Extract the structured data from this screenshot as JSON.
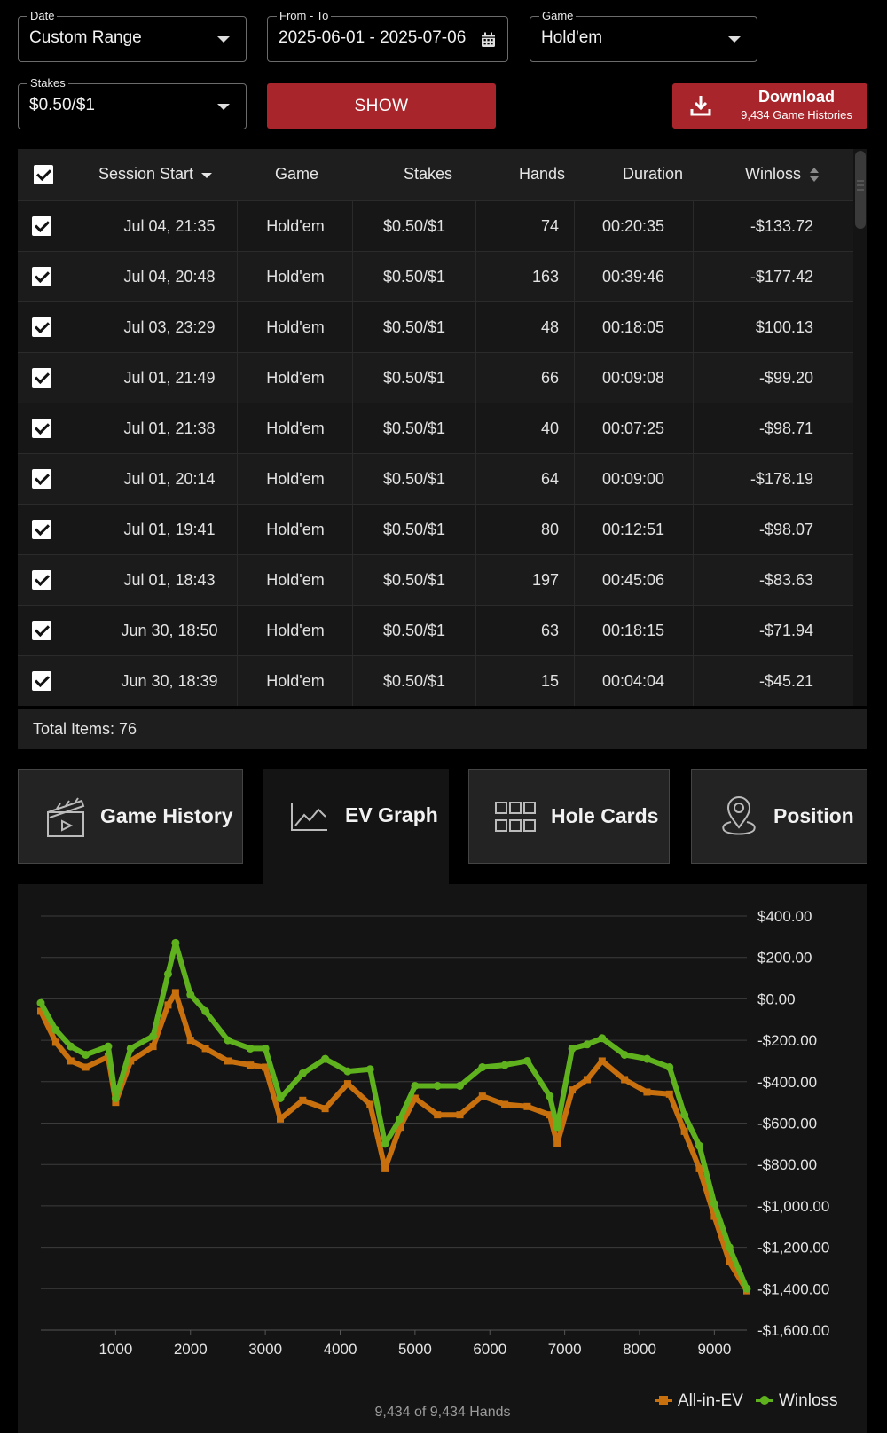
{
  "filters": {
    "date": {
      "label": "Date",
      "value": "Custom Range"
    },
    "range": {
      "label": "From - To",
      "value": "2025-06-01 - 2025-07-06"
    },
    "game": {
      "label": "Game",
      "value": "Hold'em"
    },
    "stakes": {
      "label": "Stakes",
      "value": "$0.50/$1"
    },
    "show_label": "SHOW",
    "download": {
      "title": "Download",
      "subtitle": "9,434 Game Histories"
    }
  },
  "table": {
    "headers": {
      "session_start": "Session Start",
      "game": "Game",
      "stakes": "Stakes",
      "hands": "Hands",
      "duration": "Duration",
      "winloss": "Winloss"
    },
    "rows": [
      {
        "start": "Jul 04, 21:35",
        "game": "Hold'em",
        "stakes": "$0.50/$1",
        "hands": "74",
        "duration": "00:20:35",
        "winloss": "-$133.72"
      },
      {
        "start": "Jul 04, 20:48",
        "game": "Hold'em",
        "stakes": "$0.50/$1",
        "hands": "163",
        "duration": "00:39:46",
        "winloss": "-$177.42"
      },
      {
        "start": "Jul 03, 23:29",
        "game": "Hold'em",
        "stakes": "$0.50/$1",
        "hands": "48",
        "duration": "00:18:05",
        "winloss": "$100.13"
      },
      {
        "start": "Jul 01, 21:49",
        "game": "Hold'em",
        "stakes": "$0.50/$1",
        "hands": "66",
        "duration": "00:09:08",
        "winloss": "-$99.20"
      },
      {
        "start": "Jul 01, 21:38",
        "game": "Hold'em",
        "stakes": "$0.50/$1",
        "hands": "40",
        "duration": "00:07:25",
        "winloss": "-$98.71"
      },
      {
        "start": "Jul 01, 20:14",
        "game": "Hold'em",
        "stakes": "$0.50/$1",
        "hands": "64",
        "duration": "00:09:00",
        "winloss": "-$178.19"
      },
      {
        "start": "Jul 01, 19:41",
        "game": "Hold'em",
        "stakes": "$0.50/$1",
        "hands": "80",
        "duration": "00:12:51",
        "winloss": "-$98.07"
      },
      {
        "start": "Jul 01, 18:43",
        "game": "Hold'em",
        "stakes": "$0.50/$1",
        "hands": "197",
        "duration": "00:45:06",
        "winloss": "-$83.63"
      },
      {
        "start": "Jun 30, 18:50",
        "game": "Hold'em",
        "stakes": "$0.50/$1",
        "hands": "63",
        "duration": "00:18:15",
        "winloss": "-$71.94"
      },
      {
        "start": "Jun 30, 18:39",
        "game": "Hold'em",
        "stakes": "$0.50/$1",
        "hands": "15",
        "duration": "00:04:04",
        "winloss": "-$45.21"
      }
    ],
    "total": "Total Items: 76"
  },
  "tabs": [
    {
      "label": "Game History",
      "icon": "clapperboard-icon"
    },
    {
      "label": "EV Graph",
      "icon": "line-chart-icon"
    },
    {
      "label": "Hole Cards",
      "icon": "grid-icon"
    },
    {
      "label": "Position",
      "icon": "location-pin-icon"
    }
  ],
  "chart_data": {
    "type": "line",
    "x_ticks": [
      1000,
      2000,
      3000,
      4000,
      5000,
      6000,
      7000,
      8000,
      9000
    ],
    "y_ticks": [
      400,
      200,
      0,
      -200,
      -400,
      -600,
      -800,
      -1000,
      -1200,
      -1400,
      -1600
    ],
    "y_tick_labels": [
      "$400.00",
      "$200.00",
      "$0.00",
      "-$200.00",
      "-$400.00",
      "-$600.00",
      "-$800.00",
      "-$1,000.00",
      "-$1,200.00",
      "-$1,400.00",
      "-$1,600.00"
    ],
    "xlim": [
      0,
      9434
    ],
    "ylim": [
      -1600,
      400
    ],
    "series": [
      {
        "name": "All-in-EV",
        "color": "#c8700e",
        "x": [
          0,
          200,
          400,
          600,
          900,
          1000,
          1200,
          1500,
          1700,
          1800,
          2000,
          2200,
          2500,
          2800,
          3000,
          3200,
          3500,
          3800,
          4100,
          4400,
          4600,
          4800,
          5000,
          5300,
          5600,
          5900,
          6200,
          6500,
          6800,
          6900,
          7100,
          7300,
          7500,
          7800,
          8100,
          8400,
          8600,
          8800,
          9000,
          9200,
          9434
        ],
        "y": [
          -60,
          -210,
          -300,
          -330,
          -280,
          -500,
          -300,
          -230,
          -30,
          30,
          -200,
          -240,
          -300,
          -320,
          -330,
          -580,
          -490,
          -530,
          -410,
          -510,
          -820,
          -620,
          -480,
          -560,
          -560,
          -470,
          -510,
          -520,
          -560,
          -700,
          -440,
          -390,
          -300,
          -390,
          -450,
          -460,
          -640,
          -820,
          -1050,
          -1270,
          -1410
        ]
      },
      {
        "name": "Winloss",
        "color": "#5fb21d",
        "x": [
          0,
          200,
          400,
          600,
          900,
          1000,
          1200,
          1500,
          1700,
          1800,
          2000,
          2200,
          2500,
          2800,
          3000,
          3200,
          3500,
          3800,
          4100,
          4400,
          4600,
          4800,
          5000,
          5300,
          5600,
          5900,
          6200,
          6500,
          6800,
          6900,
          7100,
          7300,
          7500,
          7800,
          8100,
          8400,
          8600,
          8800,
          9000,
          9200,
          9434
        ],
        "y": [
          -20,
          -150,
          -230,
          -270,
          -230,
          -480,
          -240,
          -180,
          120,
          270,
          20,
          -60,
          -200,
          -240,
          -240,
          -480,
          -360,
          -290,
          -350,
          -340,
          -700,
          -580,
          -420,
          -420,
          -420,
          -330,
          -320,
          -300,
          -470,
          -620,
          -240,
          -220,
          -190,
          -270,
          -290,
          -330,
          -560,
          -710,
          -990,
          -1200,
          -1400
        ]
      }
    ]
  },
  "graph_footer": "9,434 of 9,434 Hands"
}
